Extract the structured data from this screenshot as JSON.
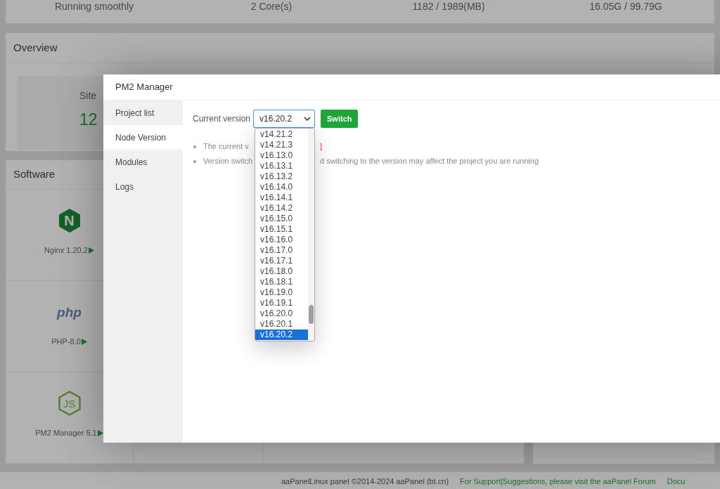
{
  "status_row": [
    "Running smoothly",
    "2 Core(s)",
    "1182 / 1989(MB)",
    "16.05G / 99.79G"
  ],
  "overview": {
    "title": "Overview",
    "cards": [
      {
        "label": "Site",
        "value": "12"
      }
    ]
  },
  "software": {
    "title": "Software",
    "items": [
      {
        "kind": "nginx",
        "logo_text": "N",
        "name": "Nginx 1.20.2"
      },
      {
        "kind": "php",
        "logo_text": "php",
        "name": "PHP-8.0"
      },
      {
        "kind": "node",
        "logo_text": "JS",
        "name": "PM2 Manager 5.1"
      }
    ]
  },
  "footer": {
    "copyright": "aaPanelLinux panel ©2014-2024 aaPanel (bt.cn)",
    "support_link": "For Support|Suggestions, please visit the aaPanel Forum",
    "docs_link": "Docu"
  },
  "modal": {
    "title": "PM2 Manager",
    "menu": [
      {
        "label": "Project list",
        "selected": false
      },
      {
        "label": "Node Version",
        "selected": true
      },
      {
        "label": "Modules",
        "selected": false
      },
      {
        "label": "Logs",
        "selected": false
      }
    ],
    "version_label": "Current version",
    "select_value": "v16.20.2",
    "switch_button": "Switch",
    "notes": [
      {
        "before": "The current v",
        "after": "]",
        "alert": true
      },
      {
        "before": "Version switch",
        "after": "d switching to the version may affect the project you are running",
        "alert": false
      }
    ],
    "dropdown": [
      {
        "label": "v14.21.2",
        "selected": false
      },
      {
        "label": "v14.21.3",
        "selected": false
      },
      {
        "label": "v16.13.0",
        "selected": false
      },
      {
        "label": "v16.13.1",
        "selected": false
      },
      {
        "label": "v16.13.2",
        "selected": false
      },
      {
        "label": "v16.14.0",
        "selected": false
      },
      {
        "label": "v16.14.1",
        "selected": false
      },
      {
        "label": "v16.14.2",
        "selected": false
      },
      {
        "label": "v16.15.0",
        "selected": false
      },
      {
        "label": "v16.15.1",
        "selected": false
      },
      {
        "label": "v16.16.0",
        "selected": false
      },
      {
        "label": "v16.17.0",
        "selected": false
      },
      {
        "label": "v16.17.1",
        "selected": false
      },
      {
        "label": "v16.18.0",
        "selected": false
      },
      {
        "label": "v16.18.1",
        "selected": false
      },
      {
        "label": "v16.19.0",
        "selected": false
      },
      {
        "label": "v16.19.1",
        "selected": false
      },
      {
        "label": "v16.20.0",
        "selected": false
      },
      {
        "label": "v16.20.1",
        "selected": false
      },
      {
        "label": "v16.20.2",
        "selected": true
      }
    ]
  }
}
